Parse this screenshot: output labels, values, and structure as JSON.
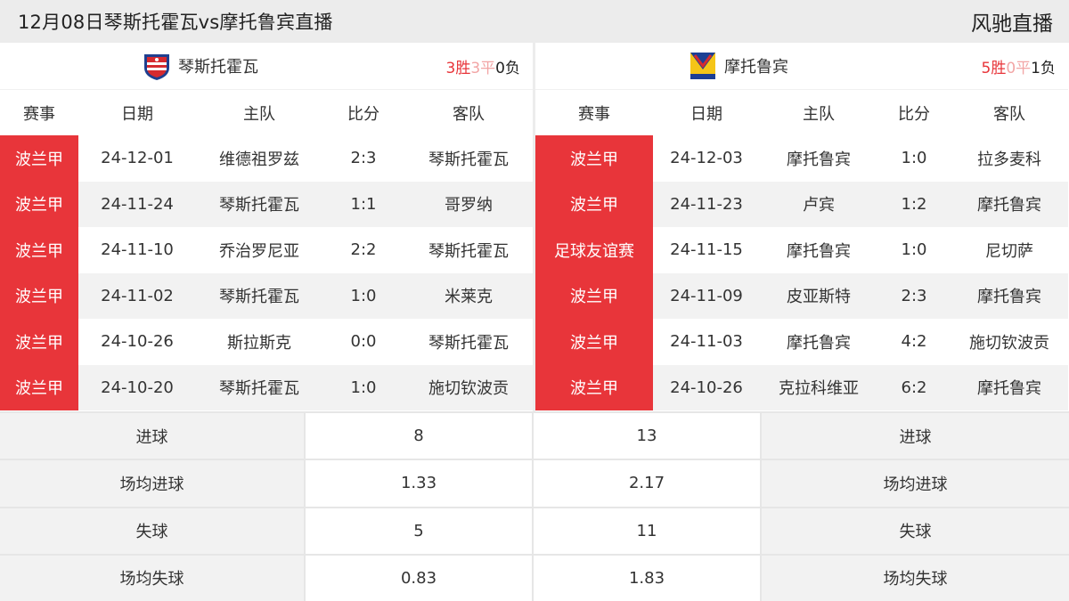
{
  "header": {
    "title": "12月08日琴斯托霍瓦vs摩托鲁宾直播",
    "brand": "风驰直播"
  },
  "columns": [
    "赛事",
    "日期",
    "主队",
    "比分",
    "客队"
  ],
  "left": {
    "team": "琴斯托霍瓦",
    "record": {
      "win": "3胜",
      "draw": "3平",
      "loss": "0负"
    },
    "matches": [
      {
        "league": "波兰甲",
        "date": "24-12-01",
        "home": "维德祖罗兹",
        "score": "2:3",
        "away": "琴斯托霍瓦"
      },
      {
        "league": "波兰甲",
        "date": "24-11-24",
        "home": "琴斯托霍瓦",
        "score": "1:1",
        "away": "哥罗纳"
      },
      {
        "league": "波兰甲",
        "date": "24-11-10",
        "home": "乔治罗尼亚",
        "score": "2:2",
        "away": "琴斯托霍瓦"
      },
      {
        "league": "波兰甲",
        "date": "24-11-02",
        "home": "琴斯托霍瓦",
        "score": "1:0",
        "away": "米莱克"
      },
      {
        "league": "波兰甲",
        "date": "24-10-26",
        "home": "斯拉斯克",
        "score": "0:0",
        "away": "琴斯托霍瓦"
      },
      {
        "league": "波兰甲",
        "date": "24-10-20",
        "home": "琴斯托霍瓦",
        "score": "1:0",
        "away": "施切钦波贡"
      }
    ]
  },
  "right": {
    "team": "摩托鲁宾",
    "record": {
      "win": "5胜",
      "draw": "0平",
      "loss": "1负"
    },
    "matches": [
      {
        "league": "波兰甲",
        "date": "24-12-03",
        "home": "摩托鲁宾",
        "score": "1:0",
        "away": "拉多麦科"
      },
      {
        "league": "波兰甲",
        "date": "24-11-23",
        "home": "卢宾",
        "score": "1:2",
        "away": "摩托鲁宾"
      },
      {
        "league": "足球友谊赛",
        "date": "24-11-15",
        "home": "摩托鲁宾",
        "score": "1:0",
        "away": "尼切萨"
      },
      {
        "league": "波兰甲",
        "date": "24-11-09",
        "home": "皮亚斯特",
        "score": "2:3",
        "away": "摩托鲁宾"
      },
      {
        "league": "波兰甲",
        "date": "24-11-03",
        "home": "摩托鲁宾",
        "score": "4:2",
        "away": "施切钦波贡"
      },
      {
        "league": "波兰甲",
        "date": "24-10-26",
        "home": "克拉科维亚",
        "score": "6:2",
        "away": "摩托鲁宾"
      }
    ]
  },
  "stats": [
    {
      "label": "进球",
      "left": "8",
      "right": "13"
    },
    {
      "label": "场均进球",
      "left": "1.33",
      "right": "2.17"
    },
    {
      "label": "失球",
      "left": "5",
      "right": "11"
    },
    {
      "label": "场均失球",
      "left": "0.83",
      "right": "1.83"
    }
  ],
  "colors": {
    "accent": "#e8353a",
    "draw": "#f2a5a5",
    "header_bg": "#ececec",
    "stripe": "#f2f2f2"
  },
  "icons": {
    "left_logo": "raków-crest-icon",
    "right_logo": "motor-lublin-crest-icon"
  }
}
